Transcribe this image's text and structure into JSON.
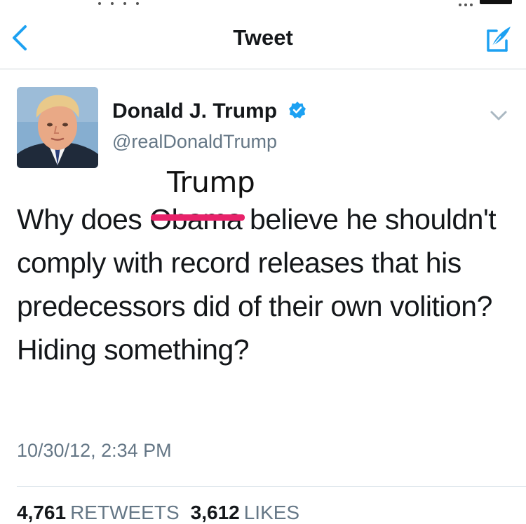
{
  "nav": {
    "title": "Tweet"
  },
  "tweet": {
    "author_name": "Donald J. Trump",
    "author_handle": "@realDonaldTrump",
    "verified": true,
    "annotation": "Trump",
    "text_before": "Why does ",
    "struck_word": "Obama",
    "text_after": " believe he shouldn't comply with record releases that his predecessors did of their own volition? Hiding something?",
    "timestamp": "10/30/12, 2:34 PM",
    "retweets_count": "4,761",
    "retweets_label": "RETWEETS",
    "likes_count": "3,612",
    "likes_label": "LIKES"
  },
  "colors": {
    "accent": "#1da1f2",
    "strike": "#e8226a",
    "secondary_text": "#657786"
  },
  "icons": {
    "back": "chevron-left-icon",
    "compose": "compose-icon",
    "verified": "verified-badge-icon",
    "more": "chevron-down-icon"
  }
}
